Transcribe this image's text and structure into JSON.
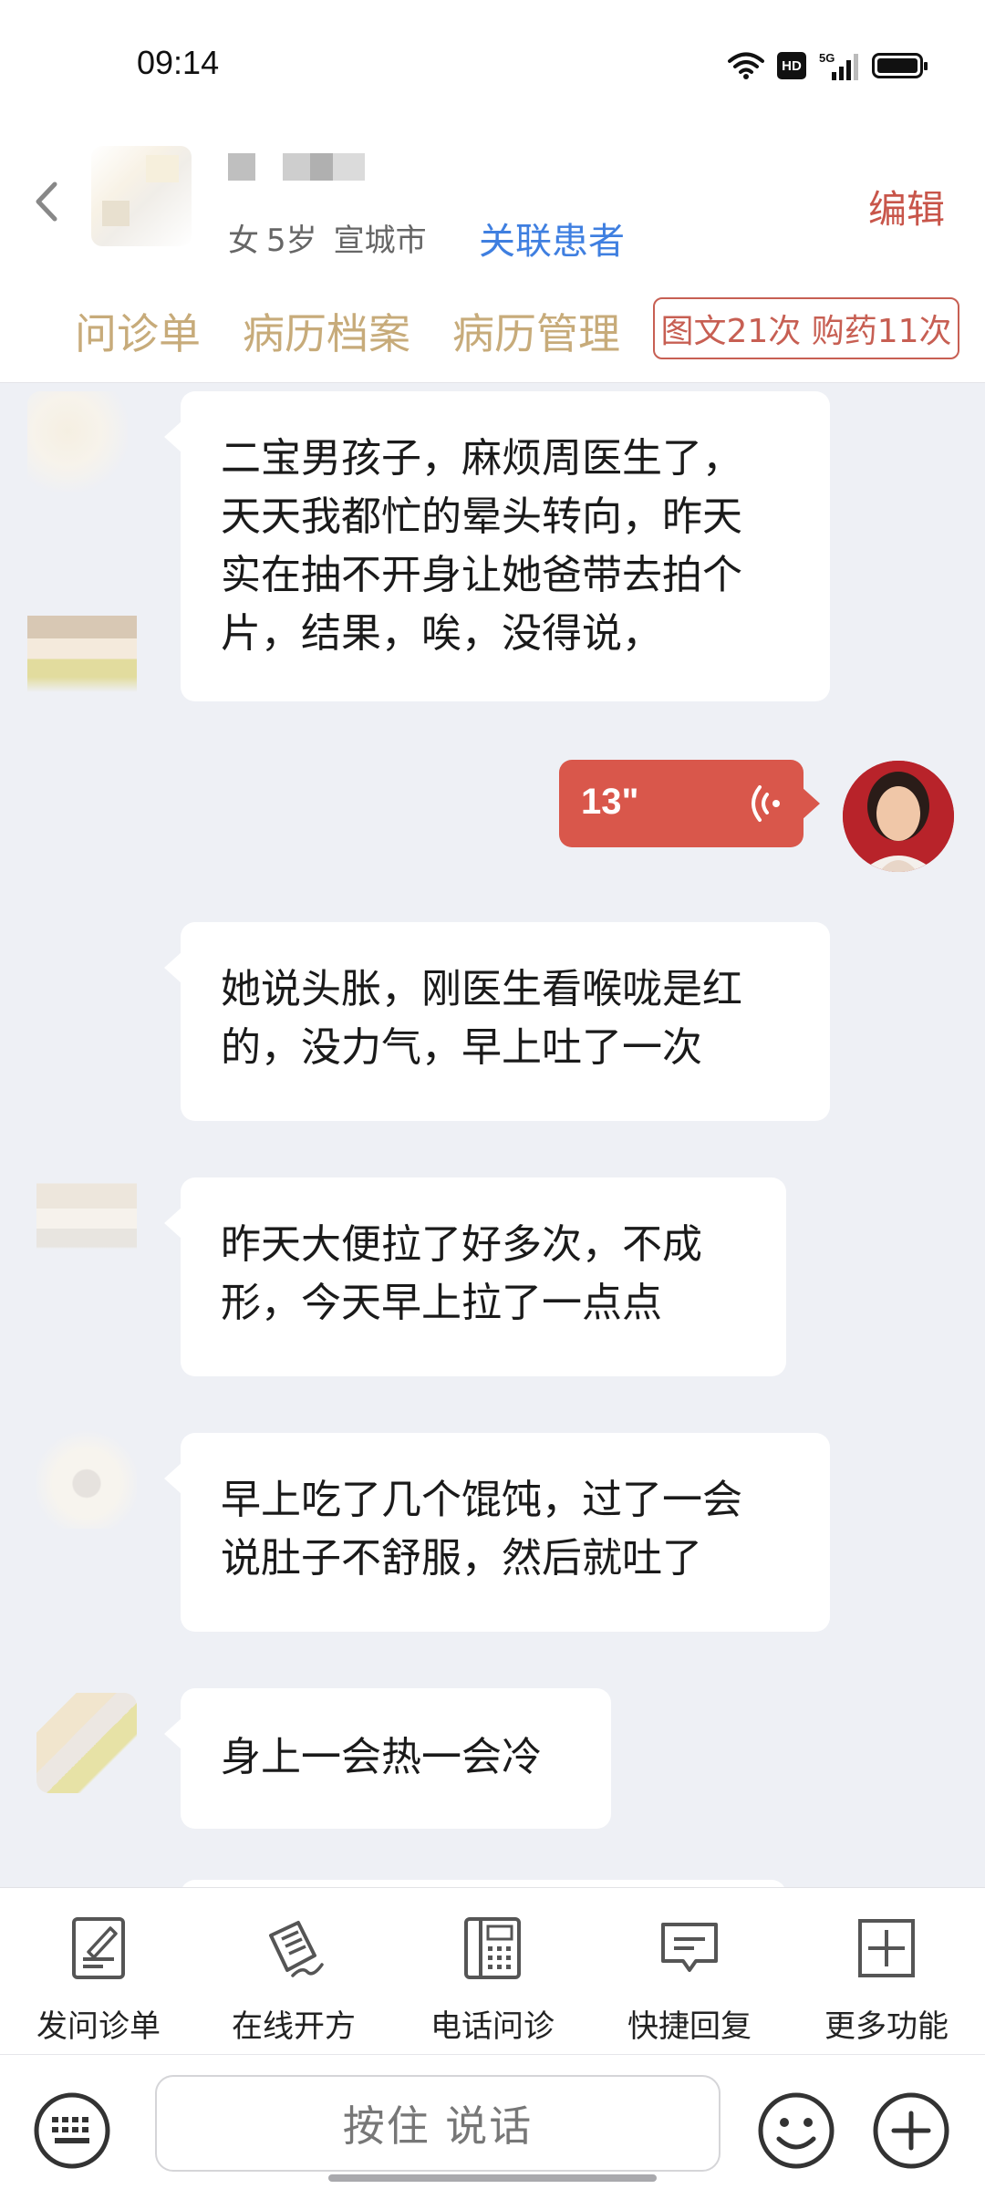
{
  "status_bar": {
    "time": "09:14",
    "hd_label": "HD",
    "network": "5G"
  },
  "header": {
    "gender": "女",
    "age": "5岁",
    "city": "宣城市",
    "link_patient": "关联患者",
    "edit": "编辑",
    "tabs": [
      "问诊单",
      "病历档案",
      "病历管理"
    ],
    "counter": "图文21次 购药11次"
  },
  "messages": [
    {
      "from": "patient",
      "text": [
        "二宝男孩子，麻烦周医生了，",
        "天天我都忙的晕头转向，昨天",
        "实在抽不开身让她爸带去拍个",
        "片，结果，唉，没得说，"
      ]
    },
    {
      "from": "doctor",
      "type": "voice",
      "duration": "13\""
    },
    {
      "from": "patient",
      "text": [
        "她说头胀，刚医生看喉咙是红",
        "的，没力气，早上吐了一次"
      ]
    },
    {
      "from": "patient",
      "text": [
        "昨天大便拉了好多次，不成",
        "形，今天早上拉了一点点"
      ]
    },
    {
      "from": "patient",
      "text": [
        "早上吃了几个馄饨，过了一会",
        "说肚子不舒服，然后就吐了"
      ]
    },
    {
      "from": "patient",
      "text": [
        "身上一会热一会冷"
      ]
    }
  ],
  "toolbar": [
    {
      "label": "发问诊单",
      "icon": "form-icon"
    },
    {
      "label": "在线开方",
      "icon": "prescription-icon"
    },
    {
      "label": "电话问诊",
      "icon": "phone-icon"
    },
    {
      "label": "快捷回复",
      "icon": "quick-reply-icon"
    },
    {
      "label": "更多功能",
      "icon": "more-icon"
    }
  ],
  "input": {
    "hold_to_talk": "按住 说话"
  },
  "colors": {
    "accent_red": "#d9574b",
    "tab_gold": "#c7ab7a",
    "link_blue": "#3f7fe0"
  }
}
